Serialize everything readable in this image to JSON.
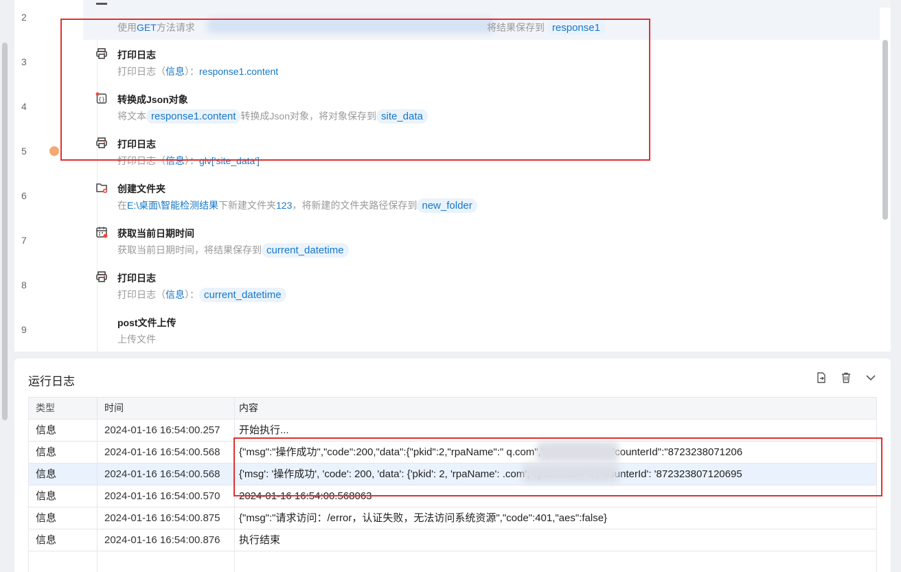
{
  "flow": {
    "line_numbers": [
      "2",
      "3",
      "4",
      "5",
      "6",
      "7",
      "8",
      "9"
    ],
    "steps": [
      {
        "title": "",
        "desc_prefix": "使用",
        "desc_method": "GET",
        "desc_middle": "方法请求",
        "desc_save": "将结果保存到",
        "desc_var": "response1",
        "icon": "http-request-icon"
      },
      {
        "title": "打印日志",
        "desc_prefix": "打印日志（",
        "desc_level": "信息",
        "desc_colon": "）：",
        "desc_value": "response1.content",
        "icon": "printer-icon"
      },
      {
        "title": "转换成Json对象",
        "desc_prefix": "将文本",
        "desc_var1": "response1.content",
        "desc_middle": "转换成Json对象，将对象保存到",
        "desc_var2": "site_data",
        "icon": "json-icon"
      },
      {
        "title": "打印日志",
        "desc_prefix": "打印日志（",
        "desc_level": "信息",
        "desc_colon": "）：",
        "desc_value": "glv['site_data']",
        "icon": "printer-icon"
      },
      {
        "title": "创建文件夹",
        "desc_prefix": "在",
        "desc_path": "E:\\桌面\\智能检测结果",
        "desc_middle": "下新建文件夹",
        "desc_name": "123",
        "desc_save": "，将新建的文件夹路径保存到",
        "desc_var": "new_folder",
        "icon": "folder-add-icon"
      },
      {
        "title": "获取当前日期时间",
        "desc_prefix": "获取当前日期时间，将结果保存到",
        "desc_var": "current_datetime",
        "icon": "calendar-icon"
      },
      {
        "title": "打印日志",
        "desc_prefix": "打印日志（",
        "desc_level": "信息",
        "desc_colon": "）：",
        "desc_value": "current_datetime",
        "icon": "printer-icon"
      },
      {
        "title": "post文件上传",
        "desc_prefix": "上传文件",
        "icon": ""
      }
    ]
  },
  "log": {
    "title": "运行日志",
    "tools": [
      "export-icon",
      "trash-icon",
      "chevron-down-icon"
    ],
    "columns": [
      "类型",
      "时间",
      "内容"
    ],
    "rows": [
      {
        "type": "信息",
        "time": "2024-01-16 16:54:00.257",
        "content": "开始执行..."
      },
      {
        "type": "信息",
        "time": "2024-01-16 16:54:00.568",
        "content": "{\"msg\":\"操作成功\",\"code\":200,\"data\":{\"pkid\":2,\"rpaName\":\"                      q.com\",\"rpaStatus\":\"0\",\"counterId\":\"8723238071206"
      },
      {
        "type": "信息",
        "time": "2024-01-16 16:54:00.568",
        "content": "{'msg': '操作成功', 'code': 200, 'data': {'pkid': 2, 'rpaName':                        .com', 'rpaStatus': '0', 'counterId': '872323807120695"
      },
      {
        "type": "信息",
        "time": "2024-01-16 16:54:00.570",
        "content": "2024-01-16 16:54:00.568063"
      },
      {
        "type": "信息",
        "time": "2024-01-16 16:54:00.875",
        "content": "{\"msg\":\"请求访问：/error，认证失败，无法访问系统资源\",\"code\":401,\"aes\":false}"
      },
      {
        "type": "信息",
        "time": "2024-01-16 16:54:00.876",
        "content": "执行结束"
      }
    ],
    "selected_row": 2
  },
  "colors": {
    "accent": "#1677c7",
    "tag_bg": "#eaf3fc",
    "highlight_box": "#e02f2f",
    "breakpoint": "#f4a874"
  }
}
